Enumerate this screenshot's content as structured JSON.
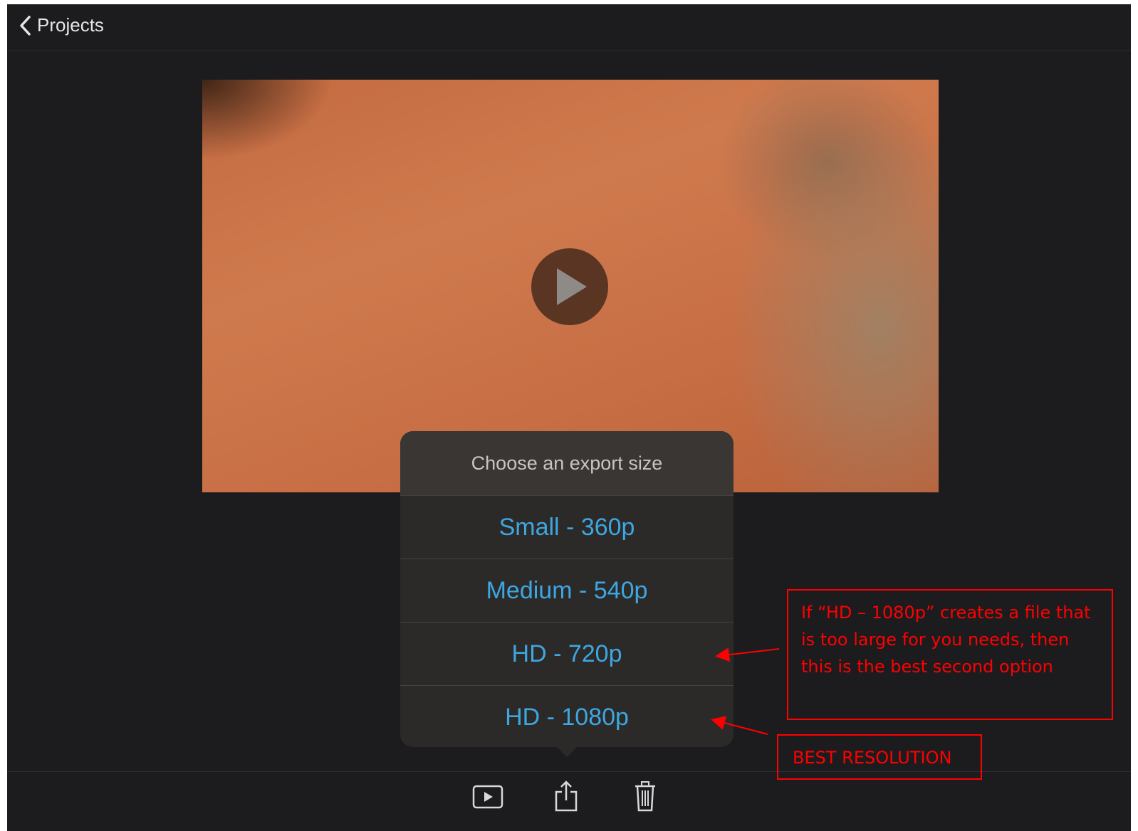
{
  "topbar": {
    "back_label": "Projects"
  },
  "popover": {
    "title": "Choose an export size",
    "options": [
      "Small - 360p",
      "Medium - 540p",
      "HD - 720p",
      "HD - 1080p"
    ]
  },
  "annotations": {
    "note1": "If “HD – 1080p” creates a file that is too large for you needs, then this is the best second option",
    "note2": "BEST RESOLUTION"
  },
  "colors": {
    "accent": "#3ea6e0",
    "annotation": "#ff0000",
    "background": "#1c1c1e"
  }
}
